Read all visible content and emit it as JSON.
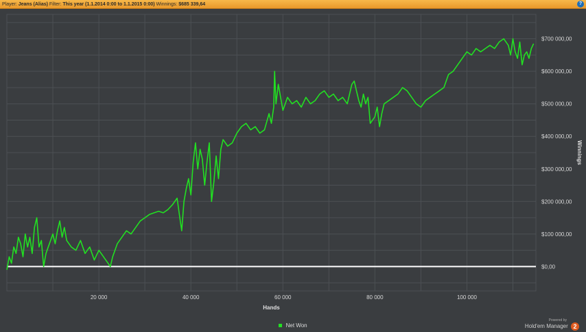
{
  "header": {
    "player_label": "Player:",
    "player_value": "Jeans (Alias)",
    "filter_label": "Filter:",
    "filter_value": "This year (1.1.2014 0:00 to 1.1.2015 0:00)",
    "winnings_label": "Winnings:",
    "winnings_value": "$685 339,64",
    "help_glyph": "?"
  },
  "legend": {
    "label": "Net Won"
  },
  "brand": {
    "powered": "Powered by",
    "name": "Hold'em Manager",
    "version": "2"
  },
  "colors": {
    "line": "#22e022",
    "zero_line": "#ffffff",
    "plot_bg": "#3a3d40",
    "grid": "#4c5054",
    "header": "#f0a535"
  },
  "chart_data": {
    "type": "line",
    "xlabel": "Hands",
    "ylabel": "Winnings",
    "xlim": [
      0,
      115000
    ],
    "ylim": [
      -75000,
      775000
    ],
    "x_ticks": [
      20000,
      40000,
      60000,
      80000,
      100000
    ],
    "x_tick_labels": [
      "20 000",
      "40 000",
      "60 000",
      "80 000",
      "100 000"
    ],
    "y_ticks": [
      0,
      100000,
      200000,
      300000,
      400000,
      500000,
      600000,
      700000
    ],
    "y_tick_labels": [
      "$0,00",
      "$100 000,00",
      "$200 000,00",
      "$300 000,00",
      "$400 000,00",
      "$500 000,00",
      "$600 000,00",
      "$700 000,00"
    ],
    "grid": true,
    "series": [
      {
        "name": "Net Won",
        "x": [
          0,
          500,
          1000,
          1500,
          2000,
          2500,
          3000,
          3500,
          4000,
          4500,
          5000,
          5500,
          6000,
          6500,
          7000,
          7500,
          8000,
          8500,
          9000,
          9500,
          10000,
          10500,
          11000,
          11500,
          12000,
          12500,
          13000,
          14000,
          15000,
          16000,
          17000,
          18000,
          19000,
          20000,
          21000,
          22000,
          22500,
          23000,
          24000,
          25000,
          26000,
          27000,
          28000,
          29000,
          30000,
          31000,
          32000,
          33000,
          34000,
          35000,
          36000,
          37000,
          37500,
          38000,
          38500,
          39000,
          39500,
          40000,
          40500,
          41000,
          41500,
          42000,
          42500,
          43000,
          43500,
          44000,
          44500,
          45000,
          45500,
          46000,
          46500,
          47000,
          48000,
          49000,
          50000,
          51000,
          52000,
          53000,
          54000,
          55000,
          56000,
          57000,
          57500,
          58000,
          58200,
          58500,
          59000,
          60000,
          61000,
          62000,
          63000,
          64000,
          65000,
          66000,
          67000,
          68000,
          69000,
          70000,
          71000,
          72000,
          73000,
          74000,
          75000,
          75500,
          76000,
          76500,
          77000,
          77500,
          78000,
          78500,
          79000,
          80000,
          80500,
          81000,
          81500,
          82000,
          83000,
          84000,
          85000,
          86000,
          87000,
          88000,
          89000,
          90000,
          91000,
          92000,
          93000,
          94000,
          95000,
          96000,
          97000,
          98000,
          99000,
          100000,
          101000,
          102000,
          103000,
          104000,
          105000,
          106000,
          107000,
          108000,
          109000,
          109500,
          110000,
          110500,
          111000,
          111500,
          112000,
          112500,
          113000,
          113500,
          114000,
          114500
        ],
        "y": [
          -10000,
          30000,
          10000,
          60000,
          40000,
          90000,
          70000,
          30000,
          100000,
          60000,
          90000,
          40000,
          120000,
          150000,
          60000,
          80000,
          0,
          40000,
          60000,
          80000,
          100000,
          70000,
          110000,
          140000,
          90000,
          120000,
          80000,
          60000,
          50000,
          80000,
          40000,
          60000,
          20000,
          50000,
          30000,
          10000,
          0,
          30000,
          70000,
          90000,
          110000,
          100000,
          120000,
          140000,
          150000,
          160000,
          165000,
          170000,
          165000,
          175000,
          190000,
          210000,
          160000,
          110000,
          200000,
          240000,
          270000,
          220000,
          320000,
          380000,
          300000,
          360000,
          330000,
          250000,
          320000,
          380000,
          200000,
          260000,
          340000,
          270000,
          360000,
          390000,
          370000,
          380000,
          410000,
          430000,
          440000,
          420000,
          430000,
          410000,
          420000,
          470000,
          440000,
          490000,
          600000,
          500000,
          560000,
          480000,
          520000,
          500000,
          510000,
          490000,
          520000,
          500000,
          510000,
          530000,
          540000,
          520000,
          530000,
          510000,
          520000,
          500000,
          560000,
          570000,
          540000,
          510000,
          490000,
          530000,
          500000,
          520000,
          440000,
          460000,
          490000,
          430000,
          470000,
          500000,
          510000,
          520000,
          530000,
          550000,
          540000,
          520000,
          500000,
          490000,
          510000,
          520000,
          530000,
          540000,
          550000,
          590000,
          600000,
          620000,
          640000,
          660000,
          650000,
          670000,
          660000,
          670000,
          680000,
          670000,
          690000,
          700000,
          680000,
          650000,
          700000,
          660000,
          640000,
          690000,
          620000,
          650000,
          660000,
          640000,
          670000,
          685000
        ]
      }
    ]
  }
}
